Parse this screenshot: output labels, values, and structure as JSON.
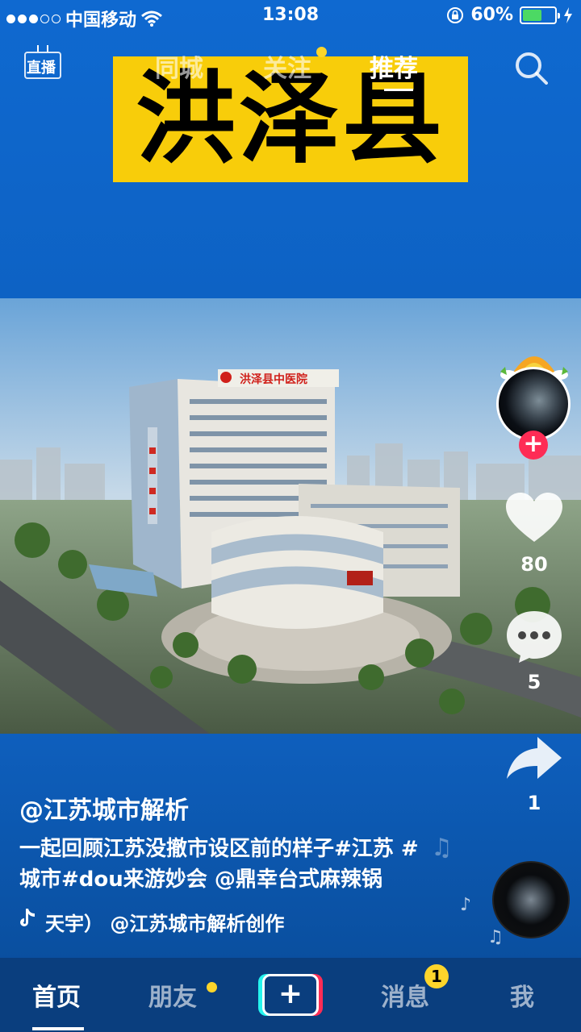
{
  "status_bar": {
    "carrier": "中国移动",
    "time": "13:08",
    "battery": "60%",
    "battery_level": 0.6
  },
  "top_nav": {
    "live_label": "直播",
    "tabs": [
      {
        "label": "同城",
        "active": false
      },
      {
        "label": "关注",
        "active": false,
        "has_dot": true
      },
      {
        "label": "推荐",
        "active": true
      }
    ],
    "search_icon": "search-icon"
  },
  "video": {
    "title_banner": "洪泽县",
    "building_sign": "洪泽县中医院"
  },
  "side_actions": {
    "like_count": "80",
    "comment_count": "5",
    "share_count": "1"
  },
  "caption": {
    "author": "@江苏城市解析",
    "description": "一起回顾江苏没撤市设区前的样子#江苏 #城市#dou来游妙会 @鼎幸台式麻辣锅",
    "music": "天宇）   @江苏城市解析创作"
  },
  "tab_bar": {
    "items": [
      {
        "label": "首页",
        "active": true
      },
      {
        "label": "朋友",
        "has_dot": true
      },
      {
        "label": "消息",
        "badge": "1"
      },
      {
        "label": "我"
      }
    ],
    "create_label": "+"
  },
  "colors": {
    "background": "#0e63c6",
    "banner": "#f8cd0a",
    "accent_red": "#fe2c55",
    "accent_cyan": "#25f4ee",
    "dot_yellow": "#fdd52b"
  }
}
